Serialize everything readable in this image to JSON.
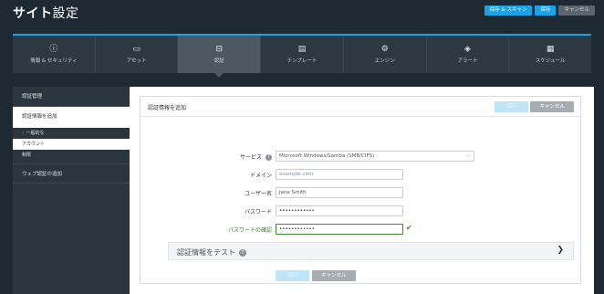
{
  "header": {
    "title_bold": "サイト",
    "title_light": "設定",
    "save_and_scan_label": "保存 & スキャン",
    "save_label": "保存",
    "cancel_label": "キャンセル"
  },
  "tabs": [
    {
      "icon": "info-icon",
      "glyph": "ⓘ",
      "label": "情報 & セキュリティ"
    },
    {
      "icon": "assets-icon",
      "glyph": "▭",
      "label": "アセット"
    },
    {
      "icon": "auth-icon",
      "glyph": "⊟",
      "label": "認証"
    },
    {
      "icon": "template-icon",
      "glyph": "▤",
      "label": "テンプレート"
    },
    {
      "icon": "engine-icon",
      "glyph": "⚙",
      "label": "エンジン"
    },
    {
      "icon": "alert-icon",
      "glyph": "◈",
      "label": "アラート"
    },
    {
      "icon": "schedule-icon",
      "glyph": "▦",
      "label": "スケジュール"
    }
  ],
  "sidebar": {
    "manage_label": "認証管理",
    "add_label": "認証情報を追加",
    "general_label": "一般的な",
    "account_label": "アカウント",
    "restrict_label": "制限",
    "web_label": "ウェブ認証の追加"
  },
  "form": {
    "title": "認証情報を追加",
    "save_label": "保存",
    "cancel_label": "キャンセル",
    "service_label": "サービス",
    "service_value": "Microsoft Windows/Samba (SMB/CIFS)",
    "domain_label": "ドメイン",
    "domain_placeholder": "example.com",
    "username_label": "ユーザー名",
    "username_value": "Jane Smith",
    "password_label": "パスワード",
    "password_value": "••••••••••••",
    "confirm_label": "パスワードの確認",
    "confirm_value": "••••••••••••",
    "test_label": "認証情報をテスト"
  },
  "colors": {
    "accent": "#1aa1e6",
    "background": "#1e2a33",
    "valid": "#3f8a2a"
  }
}
